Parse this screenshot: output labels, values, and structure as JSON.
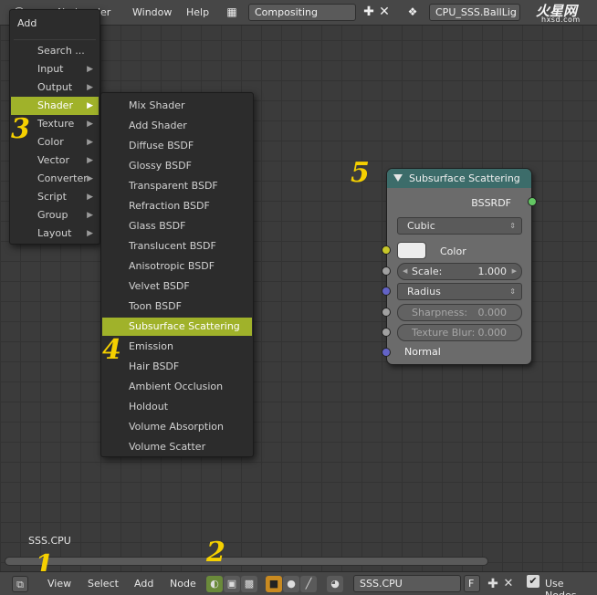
{
  "topbar": {
    "menu_node": "Node",
    "menu_render_partial": "der",
    "menu_window": "Window",
    "menu_help": "Help",
    "screen_layout": "Compositing",
    "scene": "CPU_SSS.BallLig"
  },
  "watermark": {
    "main": "火星网",
    "sub": "hxsd.com"
  },
  "add_menu": {
    "title": "Add",
    "items": [
      {
        "label": "Search ..."
      },
      {
        "label": "Input"
      },
      {
        "label": "Output"
      },
      {
        "label": "Shader"
      },
      {
        "label": "Texture"
      },
      {
        "label": "Color"
      },
      {
        "label": "Vector"
      },
      {
        "label": "Converter"
      },
      {
        "label": "Script"
      },
      {
        "label": "Group"
      },
      {
        "label": "Layout"
      }
    ],
    "active": "Shader"
  },
  "shader_menu": {
    "items": [
      {
        "label": "Mix Shader"
      },
      {
        "label": "Add Shader"
      },
      {
        "label": "Diffuse BSDF"
      },
      {
        "label": "Glossy BSDF"
      },
      {
        "label": "Transparent BSDF"
      },
      {
        "label": "Refraction BSDF"
      },
      {
        "label": "Glass BSDF"
      },
      {
        "label": "Translucent BSDF"
      },
      {
        "label": "Anisotropic BSDF"
      },
      {
        "label": "Velvet BSDF"
      },
      {
        "label": "Toon BSDF"
      },
      {
        "label": "Subsurface Scattering"
      },
      {
        "label": "Emission"
      },
      {
        "label": "Hair BSDF"
      },
      {
        "label": "Ambient Occlusion"
      },
      {
        "label": "Holdout"
      },
      {
        "label": "Volume Absorption"
      },
      {
        "label": "Volume Scatter"
      }
    ],
    "active": "Subsurface Scattering"
  },
  "node": {
    "title": "Subsurface Scattering",
    "output": "BSSRDF",
    "falloff": "Cubic",
    "color_label": "Color",
    "color_value": "#ececec",
    "scale_label": "Scale:",
    "scale_value": "1.000",
    "radius_label": "Radius",
    "sharpness_label": "Sharpness:",
    "sharpness_value": "0.000",
    "texture_blur_label": "Texture Blur:",
    "texture_blur_value": "0.000",
    "normal_label": "Normal"
  },
  "canvas": {
    "material_name": "SSS.CPU"
  },
  "annotations": [
    "1",
    "2",
    "3",
    "4",
    "5"
  ],
  "footer": {
    "view": "View",
    "select": "Select",
    "add": "Add",
    "node": "Node",
    "material": "SSS.CPU",
    "fake_user": "F",
    "use_nodes": "Use Nodes"
  },
  "colors": {
    "menu_highlight": "#a0b22a",
    "node_header": "#3c6c6a",
    "socket_shader": "#63c763",
    "socket_color": "#c7c729",
    "socket_value": "#a1a1a1",
    "socket_vector": "#6363c7",
    "annotation": "#f5d000"
  }
}
